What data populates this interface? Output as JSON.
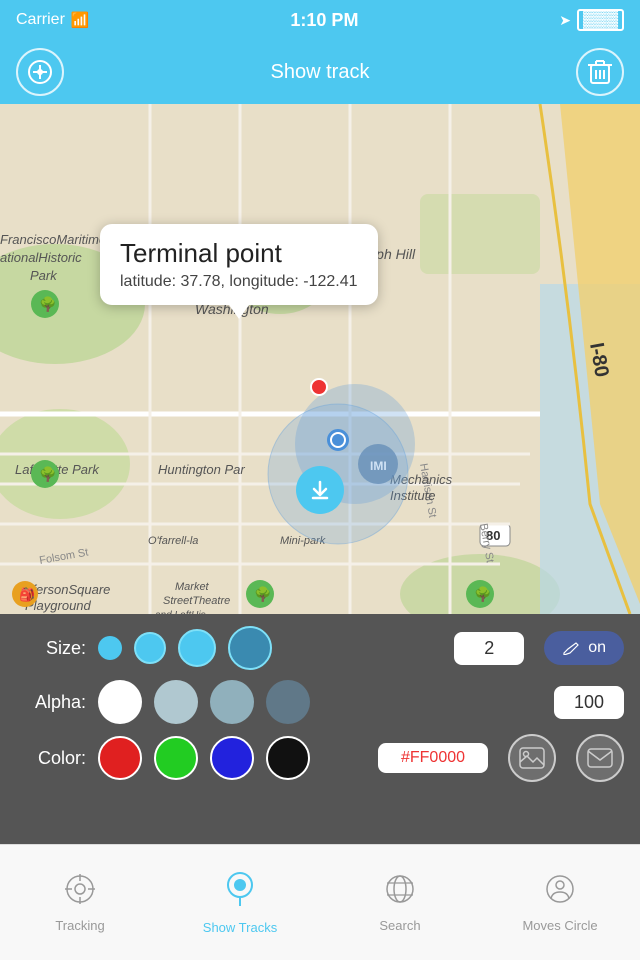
{
  "statusBar": {
    "carrier": "Carrier",
    "time": "1:10 PM",
    "batteryIcon": "▓"
  },
  "navBar": {
    "title": "Show track",
    "leftIconName": "map-pin-icon",
    "rightIconName": "trash-icon"
  },
  "map": {
    "callout": {
      "title": "Terminal point",
      "coords": "latitude: 37.78, longitude: -122.41"
    },
    "downloadButtonLabel": "↓"
  },
  "controls": {
    "sizeLabel": "Size:",
    "sizeValue": "2",
    "alphaLabel": "Alpha:",
    "alphaValue": "100",
    "colorLabel": "Color:",
    "colorHex": "#FF0000",
    "toggleLabel": "on",
    "sizeCircles": [
      {
        "bg": "#4DC8F0",
        "size": 16
      },
      {
        "bg": "#4DC8F0",
        "size": 22
      },
      {
        "bg": "#4DC8F0",
        "size": 28
      },
      {
        "bg": "#4DC8F0",
        "size": 34
      }
    ],
    "alphaCircles": [
      {
        "bg": "#ffffff",
        "opacity": 1
      },
      {
        "bg": "#b0c8d0",
        "opacity": 0.8
      },
      {
        "bg": "#90b0bc",
        "opacity": 0.6
      },
      {
        "bg": "#607888",
        "opacity": 0.4
      }
    ],
    "colorCircles": [
      {
        "bg": "#e02020"
      },
      {
        "bg": "#22cc22"
      },
      {
        "bg": "#2222dd"
      },
      {
        "bg": "#111111"
      }
    ]
  },
  "tabBar": {
    "tabs": [
      {
        "label": "Tracking",
        "icon": "crosshair",
        "active": false
      },
      {
        "label": "Show Tracks",
        "icon": "location-pin",
        "active": true
      },
      {
        "label": "Search",
        "icon": "globe",
        "active": false
      },
      {
        "label": "Moves Circle",
        "icon": "person-circle",
        "active": false
      }
    ]
  }
}
